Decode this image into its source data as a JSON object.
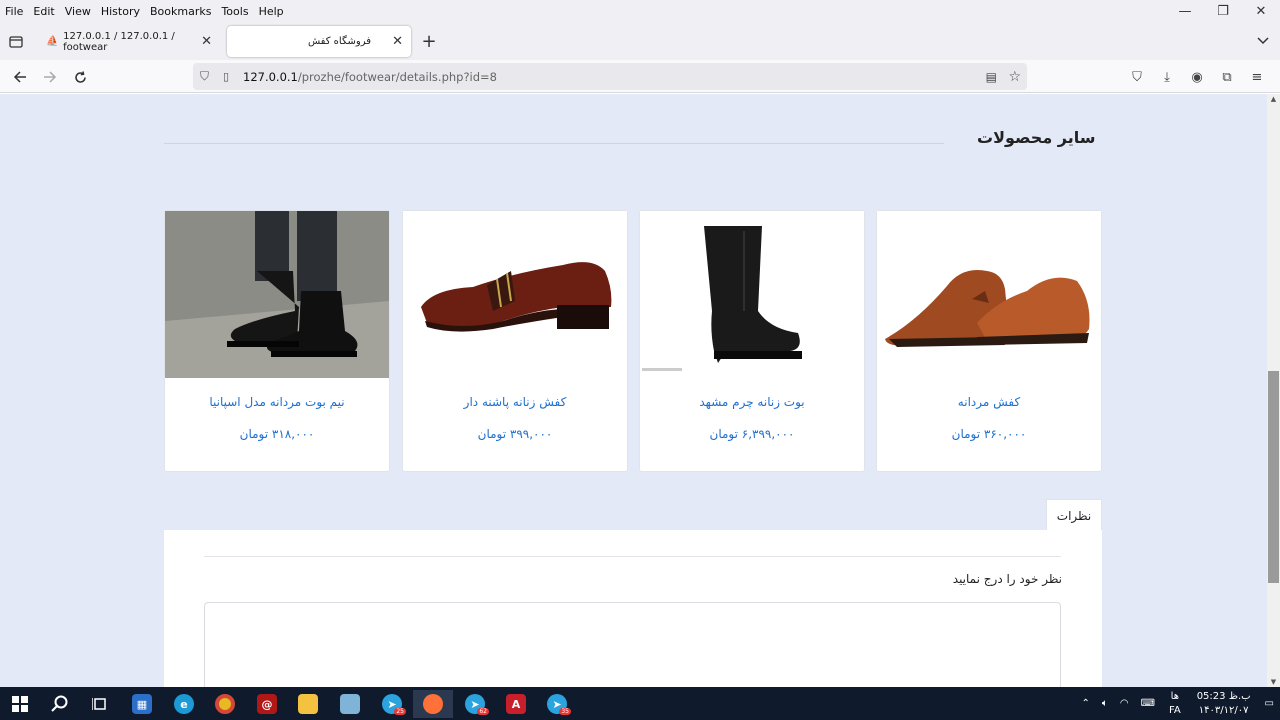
{
  "menu": [
    "File",
    "Edit",
    "View",
    "History",
    "Bookmarks",
    "Tools",
    "Help"
  ],
  "tabs": [
    {
      "title": "127.0.0.1 / 127.0.0.1 / footwear",
      "close": "✕"
    },
    {
      "title": "فروشگاه کفش",
      "close": "✕"
    }
  ],
  "url": {
    "host": "127.0.0.1",
    "path": "/prozhe/footwear/details.php?id=8"
  },
  "section_title": "سایر محصولات",
  "products": [
    {
      "name": "کفش مردانه",
      "price": "۳۶۰,۰۰۰ تومان"
    },
    {
      "name": "بوت زنانه چرم مشهد",
      "price": "۶,۳۹۹,۰۰۰ تومان"
    },
    {
      "name": "کفش زنانه پاشنه دار",
      "price": "۳۹۹,۰۰۰ تومان"
    },
    {
      "name": "نیم بوت مردانه مدل اسپانیا",
      "price": "۳۱۸,۰۰۰ تومان"
    }
  ],
  "comments": {
    "tab_label": "نظرات",
    "prompt": "نظر خود را درج نمایید"
  },
  "taskbar": {
    "badge1": "25",
    "badge2": "62",
    "badge3": "35",
    "lang": "FA",
    "ampm_label": "ب.ظ",
    "ha": "ها",
    "time": "05:23",
    "date": "۱۴۰۳/۱۲/۰۷"
  }
}
